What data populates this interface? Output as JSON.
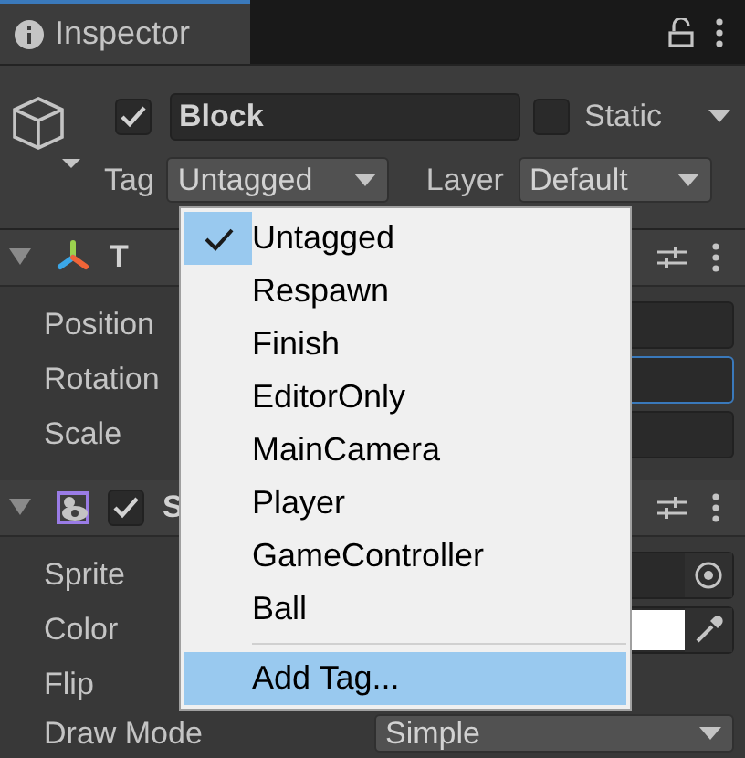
{
  "window": {
    "title": "Inspector"
  },
  "object": {
    "active": true,
    "name": "Block",
    "static": false,
    "static_label": "Static",
    "tag_label": "Tag",
    "tag": "Untagged",
    "layer_label": "Layer",
    "layer": "Default"
  },
  "components": [
    {
      "kind": "transform",
      "title": "T",
      "fields": [
        {
          "label": "Position",
          "kind": "vector",
          "focused": false
        },
        {
          "label": "Rotation",
          "kind": "vector",
          "focused": true
        },
        {
          "label": "Scale",
          "kind": "vector",
          "focused": false
        }
      ]
    },
    {
      "kind": "sprite",
      "title": "S",
      "enabled": true,
      "fields": [
        {
          "label": "Sprite",
          "kind": "object"
        },
        {
          "label": "Color",
          "kind": "color",
          "color": "#ffffff"
        },
        {
          "label": "Flip",
          "kind": "none"
        },
        {
          "label": "Draw Mode",
          "kind": "dropdown",
          "value": "Simple"
        }
      ]
    }
  ],
  "menu": {
    "items": [
      {
        "label": "Untagged",
        "selected": true
      },
      {
        "label": "Respawn",
        "selected": false
      },
      {
        "label": "Finish",
        "selected": false
      },
      {
        "label": "EditorOnly",
        "selected": false
      },
      {
        "label": "MainCamera",
        "selected": false
      },
      {
        "label": "Player",
        "selected": false
      },
      {
        "label": "GameController",
        "selected": false
      },
      {
        "label": "Ball",
        "selected": false
      }
    ],
    "action": {
      "label": "Add Tag...",
      "highlighted": true
    }
  }
}
